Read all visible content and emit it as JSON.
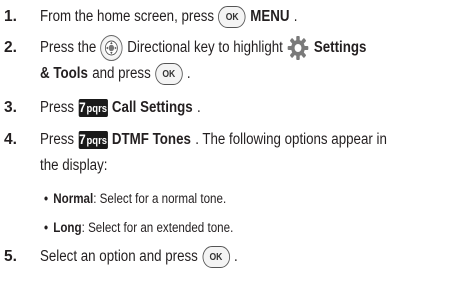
{
  "steps": [
    {
      "number": "1.",
      "pre": "From the home screen, press",
      "key": "OK",
      "bold": "MENU",
      "post": "."
    },
    {
      "number": "2.",
      "pre": "Press the",
      "key": "directional-key",
      "mid": "Directional key to highlight",
      "bold": "Settings"
    },
    {
      "cont_bold": "& Tools",
      "post": "and press",
      "key": "OK",
      "end": "."
    },
    {
      "number": "3.",
      "pre": "Press",
      "key_digit": "7",
      "key_letters": "pqrs",
      "bold": "Call Settings",
      "post": "."
    },
    {
      "number": "4.",
      "pre": "Press",
      "key_digit": "7",
      "key_letters": "pqrs",
      "bold": "DTMF Tones",
      "post": ". The following options appear in"
    },
    {
      "cont_text": "the display:"
    },
    {
      "bullet": "•",
      "bold": "Normal",
      "text": ": Select for a normal tone."
    },
    {
      "bullet": "•",
      "bold": "Long",
      "text": ": Select for an extended tone."
    },
    {
      "number": "5.",
      "pre": "Select an option and press",
      "key": "OK",
      "end": "."
    }
  ],
  "icons": {
    "ok_key": "ok-key-icon",
    "directional_key": "directional-key-icon",
    "settings": "settings-gear-icon",
    "seven_key": "seven-pqrs-key-icon"
  }
}
